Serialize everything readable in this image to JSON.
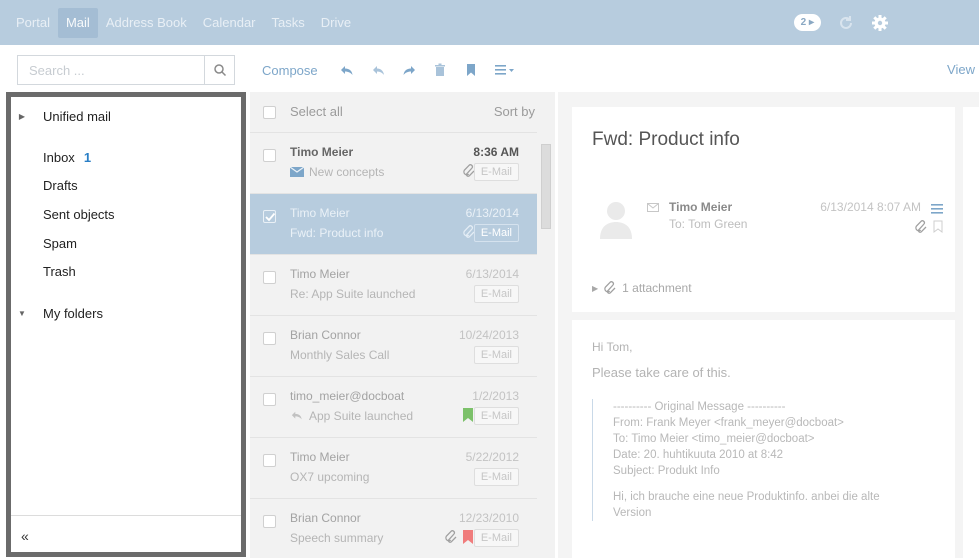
{
  "topbar": {
    "apps": [
      "Portal",
      "Mail",
      "Address Book",
      "Calendar",
      "Tasks",
      "Drive"
    ],
    "active_app": "Mail",
    "notification_count": "2"
  },
  "toolbar": {
    "search_placeholder": "Search ...",
    "compose_label": "Compose",
    "view_label": "View"
  },
  "folders": {
    "unified_label": "Unified mail",
    "items": [
      {
        "label": "Inbox",
        "count": "1"
      },
      {
        "label": "Drafts"
      },
      {
        "label": "Sent objects"
      },
      {
        "label": "Spam"
      },
      {
        "label": "Trash"
      }
    ],
    "my_folders_label": "My folders",
    "collapse_glyph": "«"
  },
  "list": {
    "select_all_label": "Select all",
    "sort_label": "Sort by",
    "items": [
      {
        "from": "Timo Meier",
        "date": "8:36 AM",
        "subject": "New concepts",
        "tag": "E-Mail",
        "unread": true,
        "icons": [
          "envelope",
          "paperclip"
        ]
      },
      {
        "from": "Timo Meier",
        "date": "6/13/2014",
        "subject": "Fwd: Product info",
        "tag": "E-Mail",
        "selected": true,
        "icons": [
          "paperclip"
        ]
      },
      {
        "from": "Timo Meier",
        "date": "6/13/2014",
        "subject": "Re: App Suite launched",
        "tag": "E-Mail"
      },
      {
        "from": "Brian Connor",
        "date": "10/24/2013",
        "subject": "Monthly Sales Call",
        "tag": "E-Mail"
      },
      {
        "from": "timo_meier@docboat",
        "date": "1/2/2013",
        "subject": "App Suite launched",
        "tag": "E-Mail",
        "icons": [
          "reply",
          "flag-green"
        ]
      },
      {
        "from": "Timo Meier",
        "date": "5/22/2012",
        "subject": "OX7 upcoming",
        "tag": "E-Mail"
      },
      {
        "from": "Brian Connor",
        "date": "12/23/2010",
        "subject": "Speech summary",
        "tag": "E-Mail",
        "icons": [
          "paperclip",
          "flag-red"
        ]
      }
    ]
  },
  "detail": {
    "title": "Fwd: Product info",
    "sender": "Timo Meier",
    "to": "To: Tom Green",
    "date": "6/13/2014 8:07 AM",
    "attachments": "1 attachment",
    "greeting": "Hi Tom,",
    "line1": "Please take care of this.",
    "quote_lines": [
      "---------- Original Message ----------",
      "From: Frank Meyer <frank_meyer@docboat>",
      "To: Timo Meier <timo_meier@docboat>",
      "Date: 20. huhtikuuta 2010 at 8:42",
      "Subject: Produkt Info"
    ],
    "quote_body": "Hi, ich brauche eine neue Produktinfo. anbei die alte Version"
  },
  "colors": {
    "topbar": "#b7ccde",
    "accent": "#7da6c9",
    "unread_count": "#2a7fc6",
    "selected_row": "#b7ccde",
    "flag_green": "#7cc16a",
    "flag_red": "#f07c7c"
  }
}
